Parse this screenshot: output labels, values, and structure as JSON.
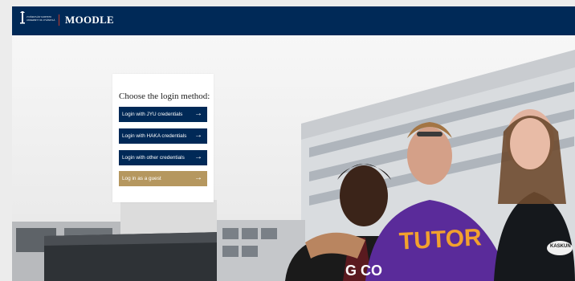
{
  "header": {
    "logo_text_line1": "JYVÄSKYLÄN YLIOPISTO",
    "logo_text_line2": "UNIVERSITY OF JYVÄSKYLÄ",
    "brand_title": "MOODLE",
    "bar_color": "#002957",
    "divider_color": "#c0392b"
  },
  "login": {
    "title": "Choose the login method:",
    "buttons": [
      {
        "label": "Login with JYU credentials",
        "icon": "arrow-right-icon"
      },
      {
        "label": "Login with HAKA credentials",
        "icon": "arrow-right-icon"
      },
      {
        "label": "Login with other credentials",
        "icon": "arrow-right-icon"
      },
      {
        "label": "Log in as a guest",
        "icon": "arrow-right-icon"
      }
    ],
    "primary_color": "#002957",
    "guest_color": "#b5975f"
  },
  "hero": {
    "shirt_text": "TUTOR",
    "shirt_text_2": "G CO",
    "jacket_badge": "KASKUN"
  }
}
